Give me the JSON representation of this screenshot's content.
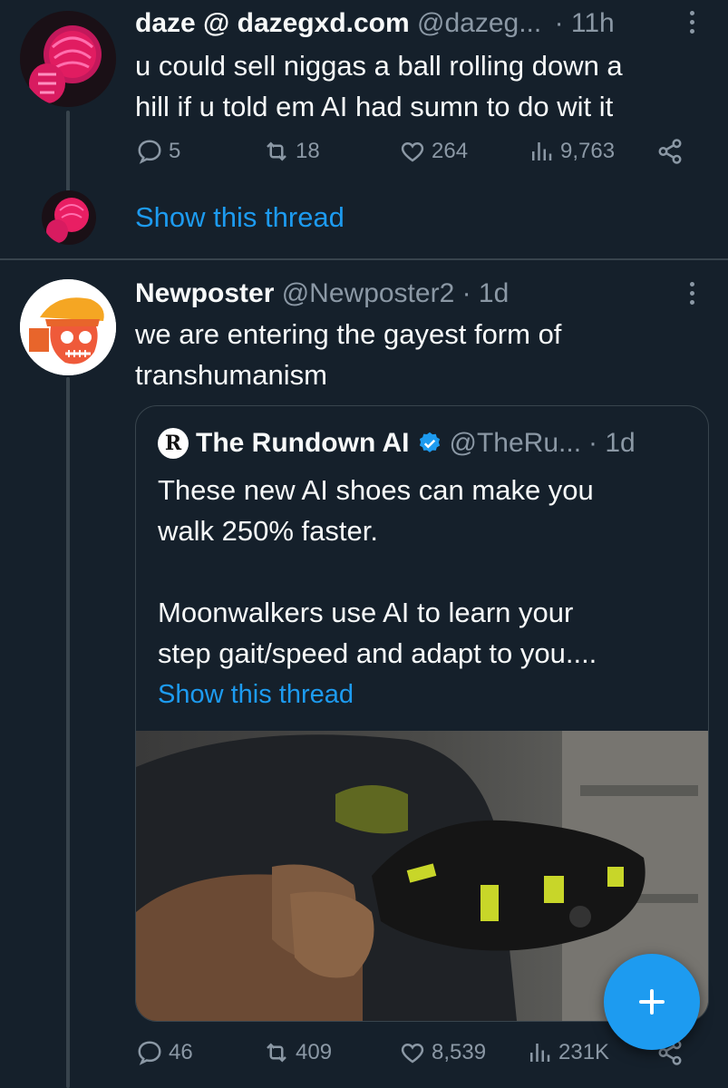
{
  "tweet1": {
    "display_name": "daze @ dazegxd.com",
    "handle": "@dazeg...",
    "time": "· 11h",
    "text_line1": "u could sell niggas a ball rolling down a",
    "text_line2": "hill if u told em AI had sumn to do wit it",
    "replies": "5",
    "reposts": "18",
    "likes": "264",
    "views": "9,763",
    "show_thread": "Show this thread"
  },
  "tweet2": {
    "display_name": "Newposter",
    "handle": "@Newposter2",
    "time": "· 1d",
    "text_line1": "we are entering the gayest form of",
    "text_line2": "transhumanism",
    "replies": "46",
    "reposts": "409",
    "likes": "8,539",
    "views": "231K"
  },
  "quote": {
    "logo_text": "R",
    "display_name": "The Rundown AI",
    "handle": "@TheRu...",
    "time": "· 1d",
    "line1": "These new AI shoes can make you",
    "line2": "walk 250% faster.",
    "line3": "Moonwalkers use AI to learn your",
    "line4": "step gait/speed and adapt to you....",
    "show_thread": "Show this thread"
  },
  "colors": {
    "background": "#15202b",
    "accent": "#1d9bf0",
    "muted": "#8b98a5",
    "divider": "#38444d"
  },
  "icons": [
    "reply-icon",
    "repost-icon",
    "like-icon",
    "views-icon",
    "share-icon",
    "more-icon",
    "verified-badge-icon",
    "compose-plus-icon"
  ]
}
